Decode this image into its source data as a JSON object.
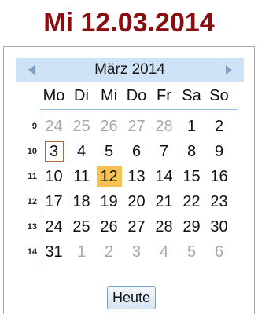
{
  "header": {
    "date_text": "Mi 12.03.2014"
  },
  "calendar": {
    "month_label": "März 2014",
    "weekdays": [
      "Mo",
      "Di",
      "Mi",
      "Do",
      "Fr",
      "Sa",
      "So"
    ],
    "weeks": [
      {
        "week": "9",
        "days": [
          {
            "d": "24",
            "in": false
          },
          {
            "d": "25",
            "in": false
          },
          {
            "d": "26",
            "in": false
          },
          {
            "d": "27",
            "in": false
          },
          {
            "d": "28",
            "in": false
          },
          {
            "d": "1",
            "in": true
          },
          {
            "d": "2",
            "in": true
          }
        ]
      },
      {
        "week": "10",
        "days": [
          {
            "d": "3",
            "in": true,
            "today": true
          },
          {
            "d": "4",
            "in": true
          },
          {
            "d": "5",
            "in": true
          },
          {
            "d": "6",
            "in": true
          },
          {
            "d": "7",
            "in": true
          },
          {
            "d": "8",
            "in": true
          },
          {
            "d": "9",
            "in": true
          }
        ]
      },
      {
        "week": "11",
        "days": [
          {
            "d": "10",
            "in": true
          },
          {
            "d": "11",
            "in": true
          },
          {
            "d": "12",
            "in": true,
            "selected": true
          },
          {
            "d": "13",
            "in": true
          },
          {
            "d": "14",
            "in": true
          },
          {
            "d": "15",
            "in": true
          },
          {
            "d": "16",
            "in": true
          }
        ]
      },
      {
        "week": "12",
        "days": [
          {
            "d": "17",
            "in": true
          },
          {
            "d": "18",
            "in": true
          },
          {
            "d": "19",
            "in": true
          },
          {
            "d": "20",
            "in": true
          },
          {
            "d": "21",
            "in": true
          },
          {
            "d": "22",
            "in": true
          },
          {
            "d": "23",
            "in": true
          }
        ]
      },
      {
        "week": "13",
        "days": [
          {
            "d": "24",
            "in": true
          },
          {
            "d": "25",
            "in": true
          },
          {
            "d": "26",
            "in": true
          },
          {
            "d": "27",
            "in": true
          },
          {
            "d": "28",
            "in": true
          },
          {
            "d": "29",
            "in": true
          },
          {
            "d": "30",
            "in": true
          }
        ]
      },
      {
        "week": "14",
        "days": [
          {
            "d": "31",
            "in": true
          },
          {
            "d": "1",
            "in": false
          },
          {
            "d": "2",
            "in": false
          },
          {
            "d": "3",
            "in": false
          },
          {
            "d": "4",
            "in": false
          },
          {
            "d": "5",
            "in": false
          },
          {
            "d": "6",
            "in": false
          }
        ]
      }
    ],
    "prev_icon": "triangle-left-icon",
    "next_icon": "triangle-right-icon"
  },
  "today_button": {
    "label": "Heute"
  },
  "colors": {
    "header_text": "#8b0d12",
    "month_bar": "#cfe3f7",
    "selected_day": "#f7c154",
    "today_border": "#b06a3a",
    "out_of_month": "#a8a8a8"
  }
}
